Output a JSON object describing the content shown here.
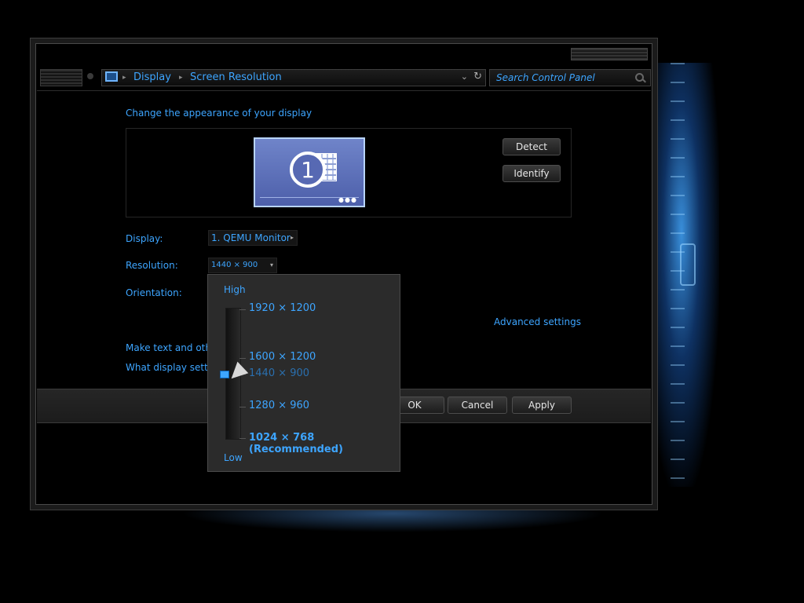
{
  "colors": {
    "accent": "#3da5ff",
    "window_bg": "#000000",
    "panel": "#2b2b2b",
    "wallpaper_glow": "#3c96e6"
  },
  "address_bar": {
    "icon": "display-monitor-icon",
    "crumbs": [
      "Display",
      "Screen Resolution"
    ]
  },
  "search": {
    "placeholder": "Search Control Panel"
  },
  "heading": "Change the appearance of your display",
  "monitor_preview": {
    "number": "1"
  },
  "buttons": {
    "detect": "Detect",
    "identify": "Identify",
    "ok": "OK",
    "cancel": "Cancel",
    "apply": "Apply"
  },
  "fields": {
    "display_label": "Display:",
    "display_value": "1. QEMU Monitor",
    "resolution_label": "Resolution:",
    "resolution_value": "1440 × 900",
    "orientation_label": "Orientation:"
  },
  "links": {
    "advanced": "Advanced settings",
    "text_size": "Make text and other",
    "which_settings": "What display setting"
  },
  "resolution_popup": {
    "high_label": "High",
    "low_label": "Low",
    "options": [
      "1920 × 1200",
      "1600 × 1200",
      "1440 × 900",
      "1280 × 960",
      "1024 × 768 (Recommended)"
    ],
    "selected": "1440 × 900",
    "recommended": "1024 × 768 (Recommended)"
  }
}
